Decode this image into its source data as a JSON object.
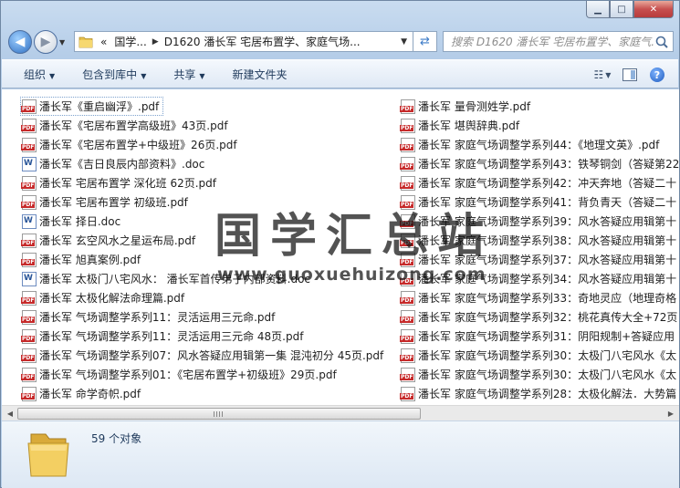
{
  "window": {
    "minimize_glyph": "▁",
    "maximize_glyph": "□",
    "close_glyph": "✕"
  },
  "nav": {
    "address_overflow": "«",
    "address_crumbs": [
      "国学...",
      "D1620 潘长军 宅居布置学、家庭气场..."
    ],
    "search_placeholder": "搜索 D1620 潘长军 宅居布置学、家庭气..."
  },
  "toolbar": {
    "organize": "组织",
    "include_in_library": "包含到库中",
    "share": "共享",
    "new_folder": "新建文件夹"
  },
  "files": {
    "left": [
      {
        "name": "潘长军《重启幽浮》.pdf",
        "type": "pdf",
        "selected": true
      },
      {
        "name": "潘长军《宅居布置学高级班》43页.pdf",
        "type": "pdf"
      },
      {
        "name": "潘长军《宅居布置学+中级班》26页.pdf",
        "type": "pdf"
      },
      {
        "name": "潘长军《吉日良辰内部资料》.doc",
        "type": "doc"
      },
      {
        "name": "潘长军 宅居布置学 深化班 62页.pdf",
        "type": "pdf"
      },
      {
        "name": "潘长军 宅居布置学 初级班.pdf",
        "type": "pdf"
      },
      {
        "name": "潘长军 择日.doc",
        "type": "doc"
      },
      {
        "name": "潘长军 玄空风水之星运布局.pdf",
        "type": "pdf"
      },
      {
        "name": "潘长军 旭真案例.pdf",
        "type": "pdf"
      },
      {
        "name": "潘长军 太极门八宅风水： 潘长军首传弟子内部资料.doc",
        "type": "doc"
      },
      {
        "name": "潘长军 太极化解法命理篇.pdf",
        "type": "pdf"
      },
      {
        "name": "潘长军 气场调整学系列11：灵活运用三元命.pdf",
        "type": "pdf"
      },
      {
        "name": "潘长军 气场调整学系列11：灵活运用三元命 48页.pdf",
        "type": "pdf"
      },
      {
        "name": "潘长军 气场调整学系列07：风水答疑应用辑第一集 混沌初分 45页.pdf",
        "type": "pdf"
      },
      {
        "name": "潘长军 气场调整学系列01：《宅居布置学+初级班》29页.pdf",
        "type": "pdf"
      },
      {
        "name": "潘长军 命学奇帜.pdf",
        "type": "pdf"
      }
    ],
    "right": [
      {
        "name": "潘长军 量骨测姓学.pdf",
        "type": "pdf"
      },
      {
        "name": "潘长军 堪舆辞典.pdf",
        "type": "pdf"
      },
      {
        "name": "潘长军 家庭气场调整学系列44：《地理文英》.pdf",
        "type": "pdf"
      },
      {
        "name": "潘长军 家庭气场调整学系列43：铁琴铜剑（答疑第22",
        "type": "pdf"
      },
      {
        "name": "潘长军 家庭气场调整学系列42：冲天奔地（答疑二十",
        "type": "pdf"
      },
      {
        "name": "潘长军 家庭气场调整学系列41：背负青天（答疑二十",
        "type": "pdf"
      },
      {
        "name": "潘长军 家庭气场调整学系列39：风水答疑应用辑第十",
        "type": "pdf"
      },
      {
        "name": "潘长军 家庭气场调整学系列38：风水答疑应用辑第十",
        "type": "pdf"
      },
      {
        "name": "潘长军 家庭气场调整学系列37：风水答疑应用辑第十",
        "type": "pdf"
      },
      {
        "name": "潘长军 家庭气场调整学系列34：风水答疑应用辑第十",
        "type": "pdf"
      },
      {
        "name": "潘长军 家庭气场调整学系列33：奇地灵应（地理奇格",
        "type": "pdf"
      },
      {
        "name": "潘长军 家庭气场调整学系列32：桃花真传大全+72页",
        "type": "pdf"
      },
      {
        "name": "潘长军 家庭气场调整学系列31：阴阳规制+答疑应用",
        "type": "pdf"
      },
      {
        "name": "潘长军 家庭气场调整学系列30：太极门八宅风水《太",
        "type": "pdf"
      },
      {
        "name": "潘长军 家庭气场调整学系列30：太极门八宅风水《太",
        "type": "pdf"
      },
      {
        "name": "潘长军 家庭气场调整学系列28：太极化解法．大势篇",
        "type": "pdf"
      }
    ]
  },
  "watermark": {
    "title": "国学汇总站",
    "url": "www.guoxuehuizong.com"
  },
  "status": {
    "count_text": "59 个对象"
  }
}
